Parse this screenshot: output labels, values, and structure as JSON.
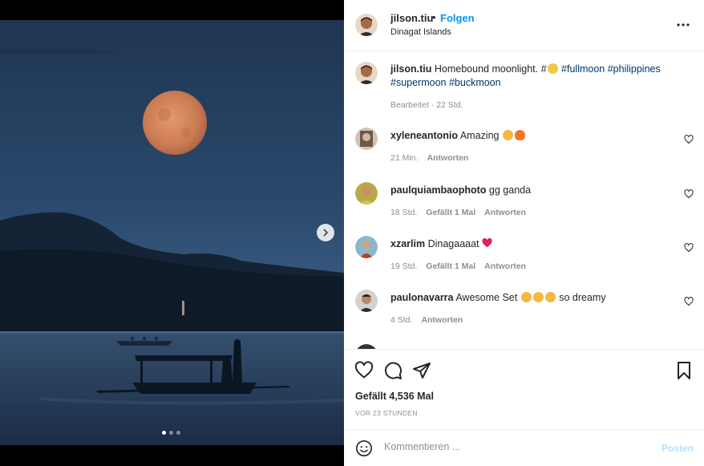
{
  "post": {
    "author": "jilson.tiu",
    "follow_label": "Folgen",
    "separator": "•",
    "location": "Dinagat Islands",
    "caption_prefix": "Homebound moonlight. #",
    "caption_tags_line1": "#fullmoon #philippines",
    "caption_tags_line2": "#supermoon #buckmoon",
    "caption_meta": "Bearbeitet · 22 Std."
  },
  "media": {
    "carousel_total": 3,
    "carousel_active": 1
  },
  "comments": [
    {
      "user": "xyleneantonio",
      "text": "Amazing",
      "time": "21 Min.",
      "likes_label": "",
      "reply_label": "Antworten"
    },
    {
      "user": "paulquiambaophoto",
      "text": "gg ganda",
      "time": "18 Std.",
      "likes_label": "Gefällt 1 Mal",
      "reply_label": "Antworten"
    },
    {
      "user": "xzarlim",
      "text": "Dinagaaaat",
      "time": "19 Std.",
      "likes_label": "Gefällt 1 Mal",
      "reply_label": "Antworten"
    },
    {
      "user": "paulonavarra",
      "text_before": "Awesome Set",
      "text_after": "so dreamy",
      "time": "4 Std.",
      "likes_label": "",
      "reply_label": "Antworten"
    }
  ],
  "actions": {
    "likes": "Gefällt 4,536 Mal",
    "posted_ago": "VOR 23 STUNDEN"
  },
  "composer": {
    "placeholder": "Kommentieren ...",
    "post_label": "Posten"
  },
  "icons": {
    "like": "heart-outline",
    "comment": "speech-bubble",
    "share": "paper-plane",
    "save": "bookmark",
    "more": "ellipsis",
    "emoji": "smiley",
    "next": "chevron-right"
  },
  "colors": {
    "link_blue": "#0095f6",
    "hashtag": "#00376b",
    "muted": "#8e8e8e",
    "post_disabled": "#b2dffc"
  }
}
